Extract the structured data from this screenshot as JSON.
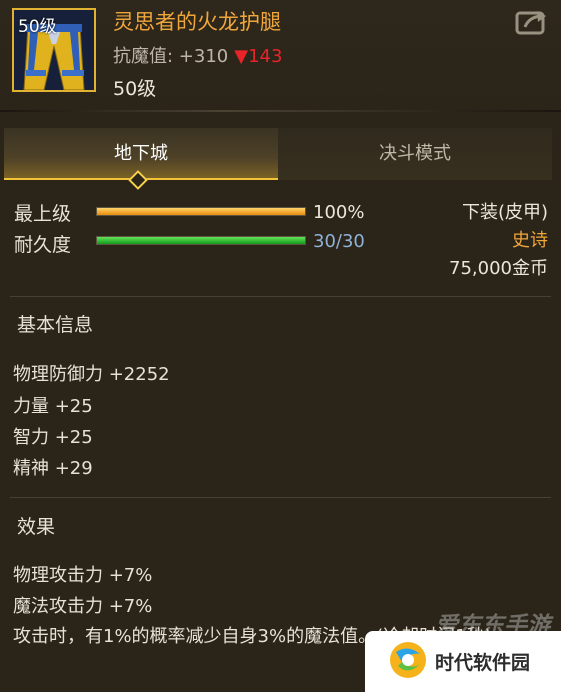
{
  "item": {
    "level_tag": "50级",
    "name": "灵思者的火龙护腿",
    "stat_label": "抗魔值: +310",
    "stat_change": "▼143",
    "level_text": "50级"
  },
  "tabs": [
    {
      "label": "地下城",
      "active": true
    },
    {
      "label": "决斗模式",
      "active": false
    }
  ],
  "bars": {
    "max_level": {
      "label": "最上级",
      "value_text": "100%",
      "fraction": 1.0
    },
    "durability": {
      "label": "耐久度",
      "value_text": "30/30",
      "fraction": 1.0
    }
  },
  "meta": {
    "slot": "下装(皮甲)",
    "rarity": "史诗",
    "price": "75,000金币"
  },
  "basic_info": {
    "title": "基本信息",
    "attributes": [
      "物理防御力 +2252",
      "力量 +25",
      "智力 +25",
      "精神 +29"
    ]
  },
  "effects": {
    "title": "效果",
    "lines": [
      "物理攻击力 +7%",
      "魔法攻击力 +7%"
    ],
    "description": "攻击时，有1%的概率减少自身3%的魔法值。(冷却时间1秒)"
  },
  "watermark": {
    "site_text": "爱东东手游",
    "brand_text": "时代软件园"
  },
  "colors": {
    "rarity_epic": "#f0a63a",
    "stat_down": "#e8232a",
    "durability_value": "#8fb2d6",
    "tab_highlight": "#f2c237"
  },
  "icons": [
    "share-icon",
    "leg-armor-icon",
    "brand-logo-icon"
  ]
}
